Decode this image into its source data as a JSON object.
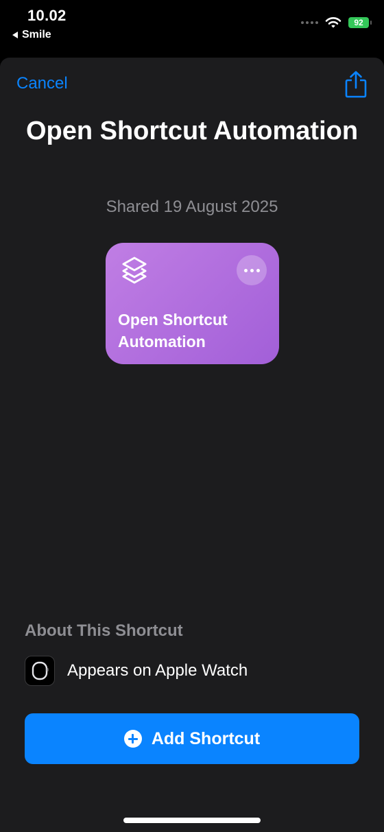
{
  "status_bar": {
    "time": "10.02",
    "back_app": "Smile",
    "battery": "92",
    "battery_color": "#34c759"
  },
  "nav": {
    "cancel_label": "Cancel",
    "share_icon": "share-icon",
    "accent_color": "#0a84ff"
  },
  "header": {
    "title": "Open Shortcut Automation",
    "shared_date": "Shared 19 August 2025"
  },
  "shortcut_card": {
    "label": "Open Shortcut Automation",
    "icon": "shortcuts-layers-icon",
    "more_icon": "ellipsis-icon",
    "color": "#b06fe0"
  },
  "about": {
    "heading": "About This Shortcut",
    "items": [
      {
        "icon": "apple-watch-icon",
        "label": "Appears on Apple Watch"
      }
    ]
  },
  "actions": {
    "add_label": "Add Shortcut",
    "add_icon": "plus-circle-icon"
  }
}
